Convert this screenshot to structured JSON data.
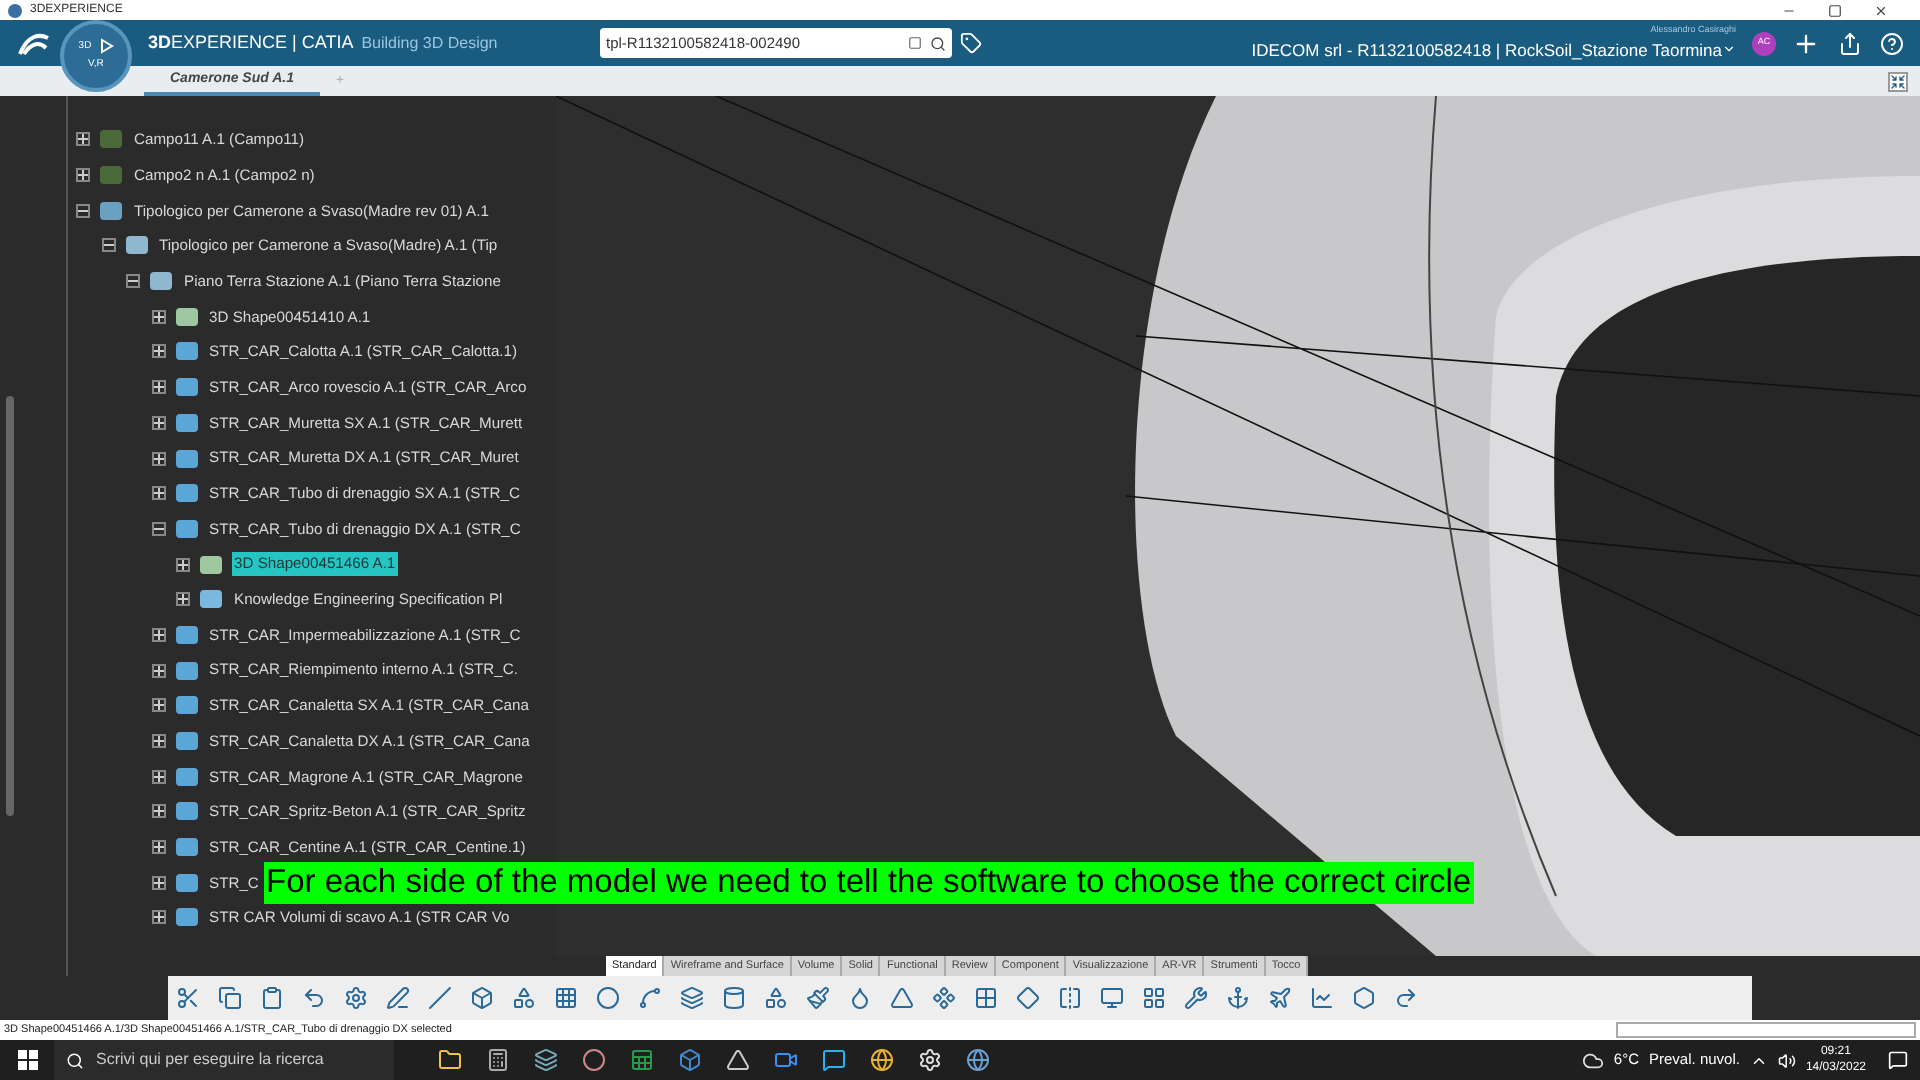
{
  "window": {
    "title": "3DEXPERIENCE"
  },
  "compass": {
    "left": "3D",
    "bottom": "V,R"
  },
  "app_bar": {
    "brand": "**3D**EXPERIENCE | CATIA",
    "role": "Building 3D Design",
    "search_value": "tpl-R1132100582418-002490",
    "user": "Alessandro Casiraghi",
    "context": "IDECOM srl - R1132100582418 | RockSoil_Stazione Taormina",
    "avatar": "AC"
  },
  "tabs": [
    {
      "label": "Camerone Sud A.1",
      "selected": true
    },
    {
      "label": "+",
      "selected": false
    }
  ],
  "tree": [
    {
      "label": "Campo11 A.1 (Campo11)",
      "kind": "group",
      "expanded": false,
      "selected": false
    },
    {
      "label": "Campo2 n A.1 (Campo2 n)",
      "kind": "group",
      "expanded": false,
      "selected": false
    },
    {
      "label": "Tipologico per Camerone a Svaso(Madre rev 01) A.1",
      "kind": "product",
      "expanded": true,
      "selected": false,
      "children": [
        {
          "label": "Tipologico per Camerone a Svaso(Madre) A.1 (Tip",
          "kind": "part",
          "expanded": true,
          "selected": false,
          "children": [
            {
              "label": "Piano Terra Stazione A.1 (Piano Terra Stazione",
              "kind": "part",
              "expanded": true,
              "selected": false,
              "children": [
                {
                  "label": "3D Shape00451410 A.1",
                  "kind": "shape",
                  "expanded": false,
                  "selected": false
                },
                {
                  "label": "STR_CAR_Calotta A.1 (STR_CAR_Calotta.1)",
                  "kind": "solid",
                  "expanded": false,
                  "selected": false
                },
                {
                  "label": "STR_CAR_Arco rovescio A.1 (STR_CAR_Arco",
                  "kind": "solid",
                  "expanded": false,
                  "selected": false
                },
                {
                  "label": "STR_CAR_Muretta SX A.1 (STR_CAR_Murett",
                  "kind": "solid",
                  "expanded": false,
                  "selected": false
                },
                {
                  "label": "STR_CAR_Muretta DX A.1 (STR_CAR_Muret",
                  "kind": "solid",
                  "expanded": false,
                  "selected": false
                },
                {
                  "label": "STR_CAR_Tubo di drenaggio SX A.1 (STR_C",
                  "kind": "solid",
                  "expanded": false,
                  "selected": false
                },
                {
                  "label": "STR_CAR_Tubo di drenaggio DX A.1 (STR_C",
                  "kind": "solid",
                  "expanded": true,
                  "selected": false,
                  "children": [
                    {
                      "label": "3D Shape00451466 A.1",
                      "kind": "shape",
                      "expanded": false,
                      "selected": true
                    },
                    {
                      "label": "Knowledge Engineering Specification Pl",
                      "kind": "knowledge",
                      "expanded": false,
                      "selected": false
                    }
                  ]
                },
                {
                  "label": "STR_CAR_Impermeabilizzazione A.1 (STR_C",
                  "kind": "solid",
                  "expanded": false,
                  "selected": false
                },
                {
                  "label": "STR_CAR_Riempimento interno A.1 (STR_C.",
                  "kind": "solid",
                  "expanded": false,
                  "selected": false
                },
                {
                  "label": "STR_CAR_Canaletta SX A.1 (STR_CAR_Cana",
                  "kind": "solid",
                  "expanded": false,
                  "selected": false
                },
                {
                  "label": "STR_CAR_Canaletta DX A.1 (STR_CAR_Cana",
                  "kind": "solid",
                  "expanded": false,
                  "selected": false
                },
                {
                  "label": "STR_CAR_Magrone A.1 (STR_CAR_Magrone",
                  "kind": "solid",
                  "expanded": false,
                  "selected": false
                },
                {
                  "label": "STR_CAR_Spritz-Beton A.1 (STR_CAR_Spritz",
                  "kind": "solid",
                  "expanded": false,
                  "selected": false
                },
                {
                  "label": "STR_CAR_Centine A.1 (STR_CAR_Centine.1)",
                  "kind": "solid",
                  "expanded": false,
                  "selected": false
                },
                {
                  "label": "STR_C",
                  "kind": "solid",
                  "expanded": false,
                  "selected": false
                },
                {
                  "label": "STR CAR Volumi di scavo A.1 (STR CAR Vo",
                  "kind": "solid",
                  "expanded": false,
                  "selected": false
                }
              ]
            }
          ]
        }
      ]
    }
  ],
  "caption": "For each side of the model we need to tell the software to choose the correct circle",
  "toolbar_tabs": [
    {
      "label": "Standard",
      "selected": true
    },
    {
      "label": "Wireframe and Surface",
      "selected": false
    },
    {
      "label": "Volume",
      "selected": false
    },
    {
      "label": "Solid",
      "selected": false
    },
    {
      "label": "Functional",
      "selected": false
    },
    {
      "label": "Review",
      "selected": false
    },
    {
      "label": "Component",
      "selected": false
    },
    {
      "label": "Visualizzazione",
      "selected": false
    },
    {
      "label": "AR-VR",
      "selected": false
    },
    {
      "label": "Strumenti",
      "selected": false
    },
    {
      "label": "Tocco",
      "selected": false
    }
  ],
  "status_bar": {
    "text": "3D Shape00451466 A.1/3D Shape00451466 A.1/STR_CAR_Tubo di drenaggio DX selected"
  },
  "taskbar": {
    "search_placeholder": "Scrivi qui per eseguire la ricerca",
    "temperature": "6°C",
    "weather": "Preval. nuvol.",
    "time": "09:21",
    "date": "14/03/2022"
  }
}
